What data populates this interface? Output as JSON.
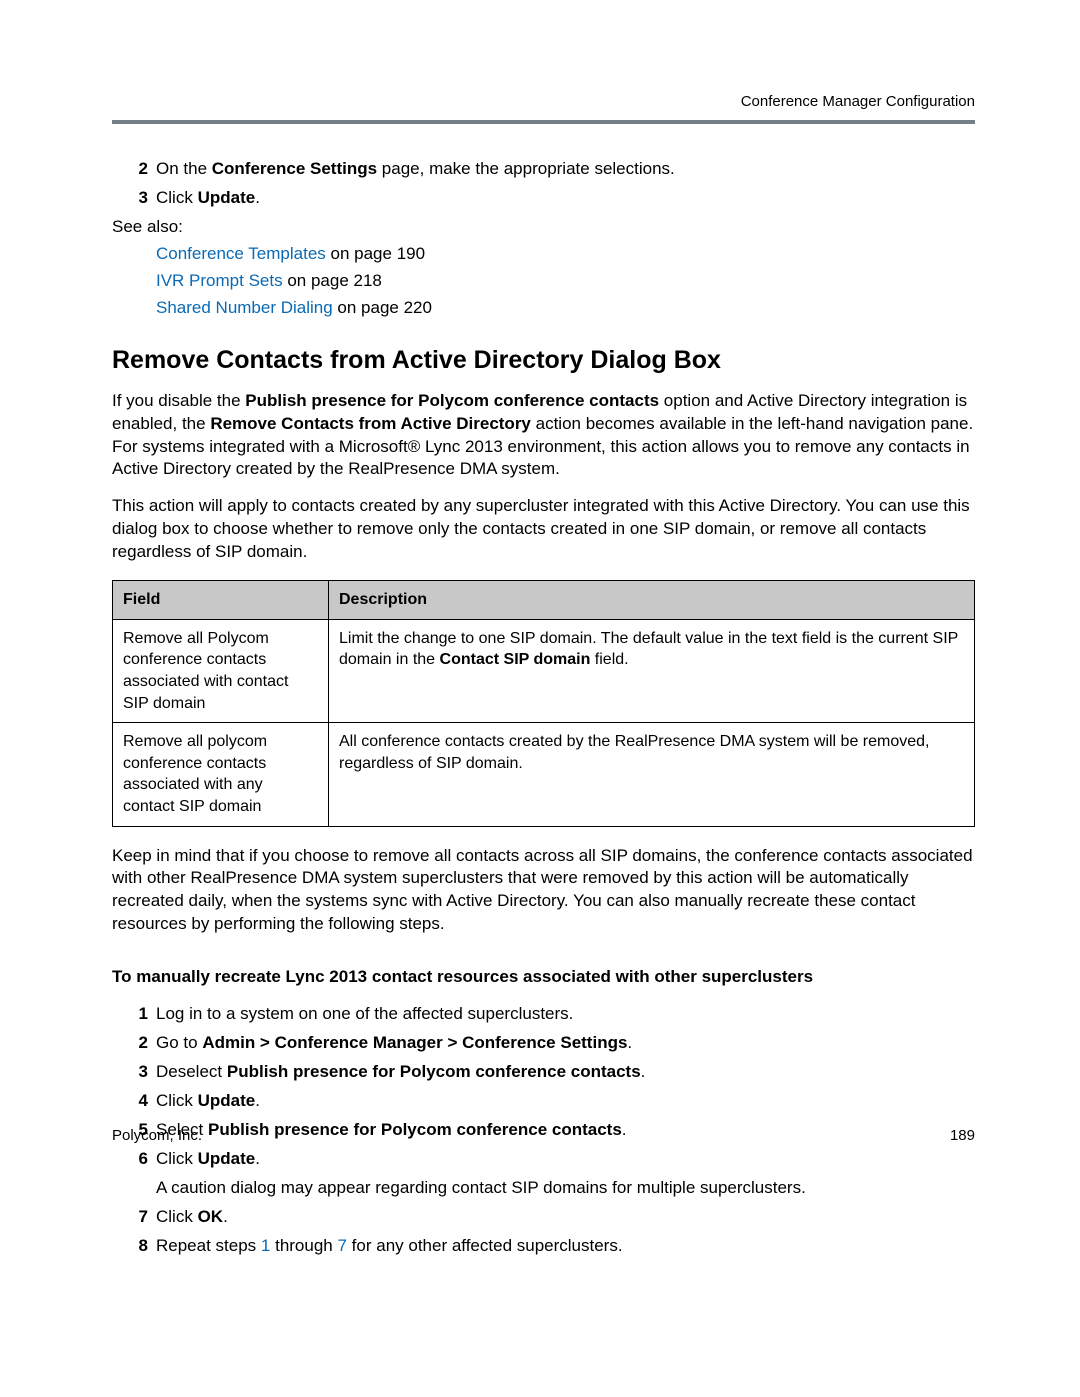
{
  "running_head": "Conference Manager Configuration",
  "intro_steps": [
    {
      "n": "2",
      "before": "On the ",
      "bold": "Conference Settings",
      "after": " page, make the appropriate selections."
    },
    {
      "n": "3",
      "before": "Click ",
      "bold": "Update",
      "after": "."
    }
  ],
  "see_also_label": "See also:",
  "see_also": [
    {
      "link": "Conference Templates",
      "suffix": " on page 190"
    },
    {
      "link": "IVR Prompt Sets",
      "suffix": " on page 218"
    },
    {
      "link": "Shared Number Dialing",
      "suffix": " on page 220"
    }
  ],
  "section_title": "Remove Contacts from Active Directory Dialog Box",
  "para1": {
    "t1": "If you disable the ",
    "b1": "Publish presence for Polycom conference contacts",
    "t2": " option and Active Directory integration is enabled, the ",
    "b2": "Remove Contacts from Active Directory",
    "t3": " action becomes available in the left-hand navigation pane. For systems integrated with a Microsoft® Lync 2013 environment, this action allows you to remove any contacts in Active Directory created by the RealPresence DMA system."
  },
  "para2": "This action will apply to contacts created by any supercluster integrated with this Active Directory. You can use this dialog box to choose whether to remove only the contacts created in one SIP domain, or remove all contacts regardless of SIP domain.",
  "table": {
    "head_field": "Field",
    "head_desc": "Description",
    "rows": [
      {
        "field": "Remove all Polycom conference contacts associated with contact SIP domain",
        "desc_before": "Limit the change to one SIP domain. The default value in the text field is the current SIP domain in the ",
        "desc_bold": "Contact SIP domain",
        "desc_after": " field."
      },
      {
        "field": "Remove all polycom conference contacts associated with any contact SIP domain",
        "desc_before": "All conference contacts created by the RealPresence DMA system will be removed, regardless of SIP domain.",
        "desc_bold": "",
        "desc_after": ""
      }
    ]
  },
  "para3": "Keep in mind that if you choose to remove all contacts across all SIP domains, the conference contacts associated with other RealPresence DMA system superclusters that were removed by this action will be automatically recreated daily, when the systems sync with Active Directory. You can also manually recreate these contact resources by performing the following steps.",
  "subhead": "To manually recreate Lync 2013 contact resources associated with other superclusters",
  "steps": {
    "s1": "Log in to a system on one of the affected superclusters.",
    "s2_a": "Go to ",
    "s2_b": "Admin > Conference Manager > Conference Settings",
    "s2_c": ".",
    "s3_a": "Deselect ",
    "s3_b": "Publish presence for Polycom conference contacts",
    "s3_c": ".",
    "s4_a": "Click ",
    "s4_b": "Update",
    "s4_c": ".",
    "s5_a": "Select ",
    "s5_b": "Publish presence for Polycom conference contacts",
    "s5_c": ".",
    "s6_a": "Click ",
    "s6_b": "Update",
    "s6_c": ".",
    "s6_sub": "A caution dialog may appear regarding contact SIP domains for multiple superclusters.",
    "s7_a": "Click ",
    "s7_b": "OK",
    "s7_c": ".",
    "s8_a": "Repeat steps ",
    "s8_link1": "1",
    "s8_mid": " through ",
    "s8_link2": "7",
    "s8_b": " for any other affected superclusters."
  },
  "step_nums": {
    "n1": "1",
    "n2": "2",
    "n3": "3",
    "n4": "4",
    "n5": "5",
    "n6": "6",
    "n7": "7",
    "n8": "8"
  },
  "footer_left": "Polycom, Inc.",
  "footer_right": "189"
}
